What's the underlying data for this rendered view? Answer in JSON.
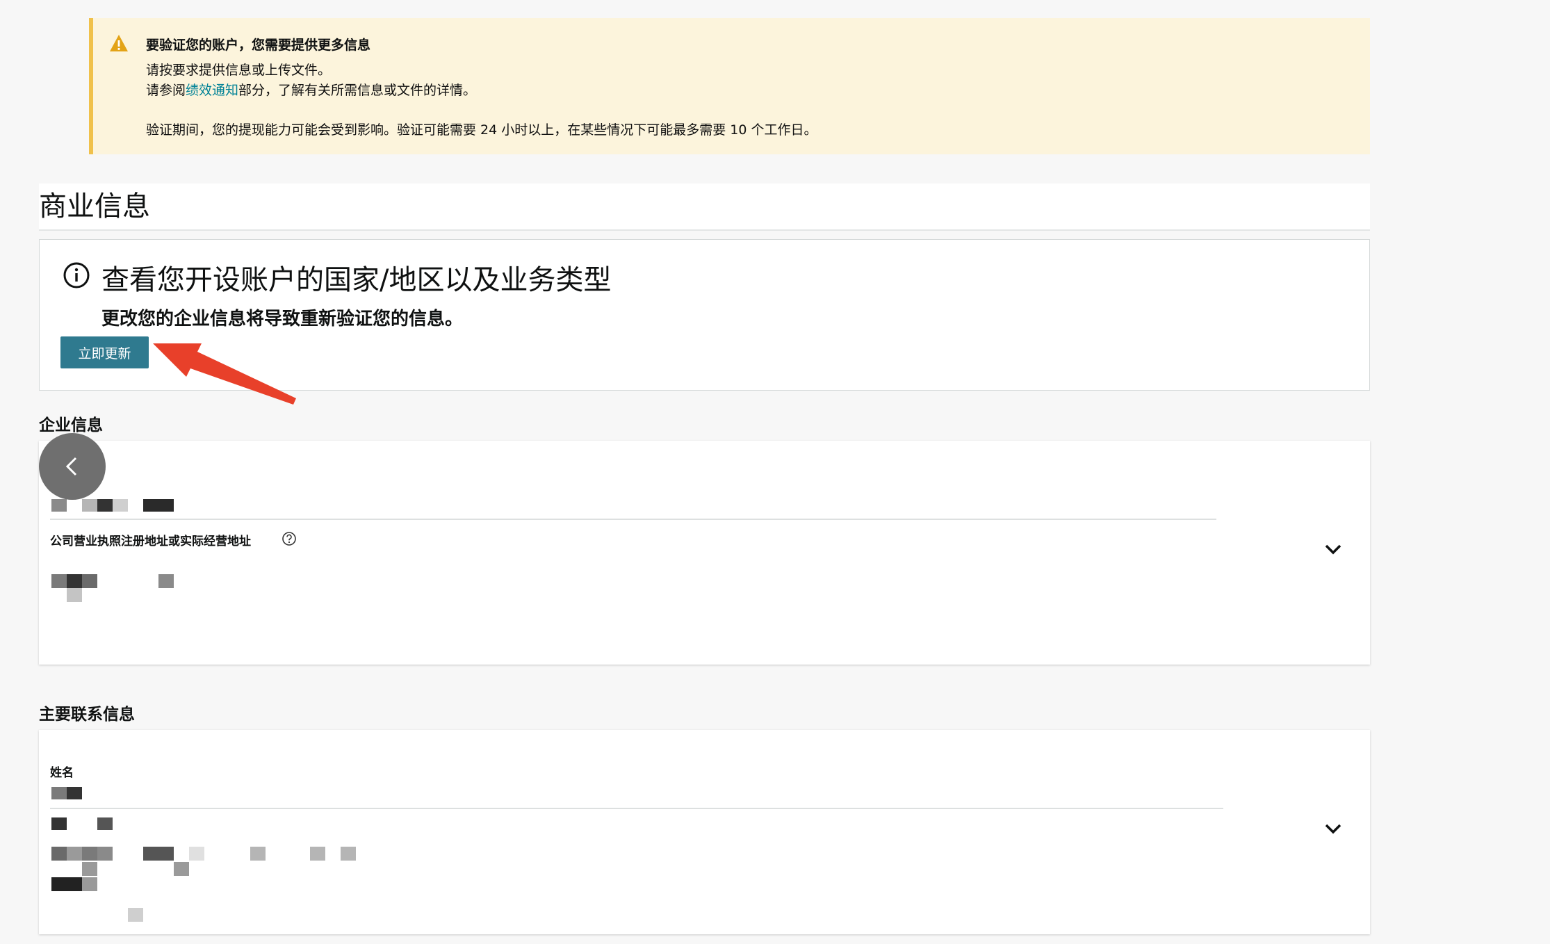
{
  "alert": {
    "title": "要验证您的账户，您需要提供更多信息",
    "line1": "请按要求提供信息或上传文件。",
    "line2_prefix": "请参阅",
    "line2_link": "绩效通知",
    "line2_suffix": "部分，了解有关所需信息或文件的详情。",
    "line3": "验证期间，您的提现能力可能会受到影响。验证可能需要 24 小时以上，在某些情况下可能最多需要 10 个工作日。",
    "icon": "warning-icon"
  },
  "section": {
    "title": "商业信息"
  },
  "infobox": {
    "heading": "查看您开设账户的国家/地区以及业务类型",
    "subtext": "更改您的企业信息将导致重新验证您的信息。",
    "button_label": "立即更新",
    "icon": "info-circle-icon"
  },
  "company": {
    "label": "企业信息",
    "address_label": "公司营业执照注册地址或实际经营地址"
  },
  "contact": {
    "label": "主要联系信息",
    "name_label": "姓名"
  },
  "colors": {
    "accent": "#2f7a8f",
    "link": "#008296",
    "alert_bg": "#fcf4dc",
    "alert_border": "#f0c14b",
    "annotation_arrow": "#e8402a"
  }
}
